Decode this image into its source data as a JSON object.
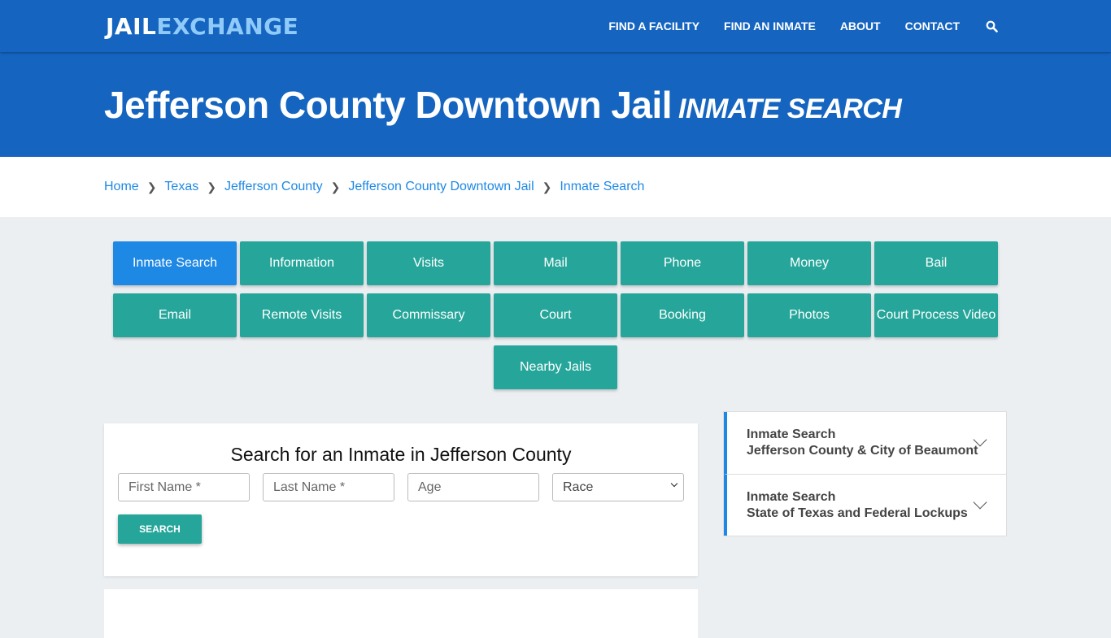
{
  "brand": {
    "part1": "JAIL",
    "part2": "EXCHANGE"
  },
  "nav": {
    "items": [
      "FIND A FACILITY",
      "FIND AN INMATE",
      "ABOUT",
      "CONTACT"
    ],
    "search_icon": "search-icon"
  },
  "hero": {
    "title": "Jefferson County Downtown Jail",
    "subtitle": "INMATE SEARCH"
  },
  "breadcrumb": [
    "Home",
    "Texas",
    "Jefferson County",
    "Jefferson County Downtown Jail",
    "Inmate Search"
  ],
  "buttons": [
    "Inmate Search",
    "Information",
    "Visits",
    "Mail",
    "Phone",
    "Money",
    "Bail",
    "Email",
    "Remote Visits",
    "Commissary",
    "Court",
    "Booking",
    "Photos",
    "Court Process Video",
    "Nearby Jails"
  ],
  "active_button": "Inmate Search",
  "search": {
    "heading": "Search for an Inmate in Jefferson County",
    "first_placeholder": "First Name *",
    "last_placeholder": "Last Name *",
    "age_placeholder": "Age",
    "race_selected": "Race",
    "button": "SEARCH"
  },
  "sidebar": [
    {
      "line1": "Inmate Search",
      "line2": "Jefferson County & City of Beaumont"
    },
    {
      "line1": "Inmate Search",
      "line2": "State of Texas and Federal Lockups"
    }
  ]
}
